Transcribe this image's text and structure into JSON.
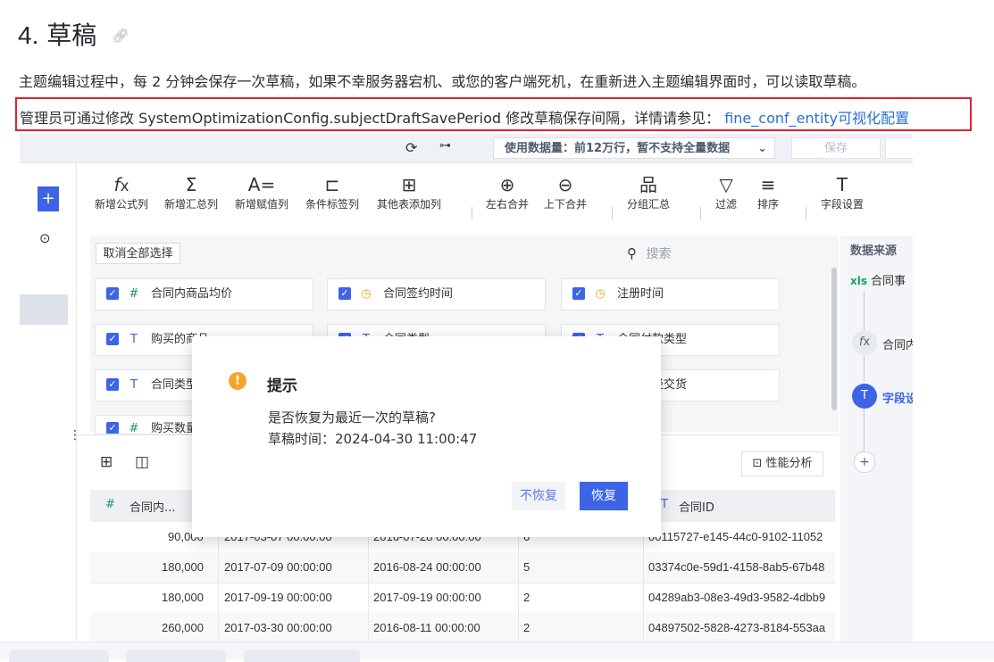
{
  "heading": {
    "number": "4.",
    "title": "草稿",
    "link_icon": "link-icon"
  },
  "para1": "主题编辑过程中，每 2 分钟会保存一次草稿，如果不幸服务器宕机、或您的客户端死机，在重新进入主题编辑界面时，可以读取草稿。",
  "para2": {
    "text": "管理员可通过修改 SystemOptimizationConfig.subjectDraftSavePeriod 修改草稿保存间隔，详情请参见：",
    "link": "fine_conf_entity可视化配置"
  },
  "app": {
    "topbar": {
      "usage_label": "使用数据量：前12万行，暂不支持全量数据",
      "save_label": "保存"
    },
    "toolbar": [
      {
        "label": "新增公式列",
        "icon": "fx"
      },
      {
        "label": "新增汇总列",
        "icon": "Σ"
      },
      {
        "label": "新增赋值列",
        "icon": "A="
      },
      {
        "label": "条件标签列",
        "icon": "⊏"
      },
      {
        "label": "其他表添加列",
        "icon": "⊞"
      },
      {
        "label": "左右合并",
        "icon": "⊕"
      },
      {
        "label": "上下合并",
        "icon": "⊖"
      },
      {
        "label": "分组汇总",
        "icon": "品"
      },
      {
        "label": "过滤",
        "icon": "▽"
      },
      {
        "label": "排序",
        "icon": "≡"
      },
      {
        "label": "字段设置",
        "icon": "T"
      }
    ],
    "clear_all_label": "取消全部选择",
    "search_placeholder": "搜索",
    "fields": [
      {
        "type": "#",
        "label": "合同内商品均价"
      },
      {
        "type": "clock",
        "label": "合同签约时间"
      },
      {
        "type": "clock",
        "label": "注册时间"
      },
      {
        "type": "T",
        "label": "购买的商品"
      },
      {
        "type": "T",
        "label": "合同类型"
      },
      {
        "type": "T",
        "label": "合同付款类型"
      },
      {
        "type": "T",
        "label": "合同类型"
      },
      {
        "type": "T",
        "label": ""
      },
      {
        "type": "T",
        "label": "是否已经交货"
      },
      {
        "type": "#",
        "label": "购买数量"
      }
    ],
    "right_panel": {
      "title": "数据来源",
      "source": "合同事",
      "nodes": [
        "合同内",
        "字段设"
      ]
    },
    "perf_label": "性能分析",
    "table": {
      "headers": [
        "合同内...",
        "",
        "",
        "",
        "合同ID"
      ],
      "rows": [
        [
          "90,000",
          "2017-03-07 00:00:00",
          "2016-07-28 00:00:00",
          "6",
          "00115727-e145-44c0-9102-11052"
        ],
        [
          "180,000",
          "2017-07-09 00:00:00",
          "2016-08-24 00:00:00",
          "5",
          "03374c0e-59d1-4158-8ab5-67b48"
        ],
        [
          "180,000",
          "2017-09-19 00:00:00",
          "2017-09-19 00:00:00",
          "2",
          "04289ab3-08e3-49d3-9582-4dbb9"
        ],
        [
          "260,000",
          "2017-03-30 00:00:00",
          "2016-08-11 00:00:00",
          "2",
          "04897502-5828-4273-8184-553aa"
        ]
      ]
    },
    "dialog": {
      "title": "提示",
      "message": "是否恢复为最近一次的草稿?",
      "time": "草稿时间：2024-04-30 11:00:47",
      "cancel_label": "不恢复",
      "confirm_label": "恢复"
    }
  },
  "colors": {
    "accent": "#3d63e7",
    "highlight_border": "#e0222b",
    "link": "#2a6fd6",
    "warning": "#f3a629"
  }
}
